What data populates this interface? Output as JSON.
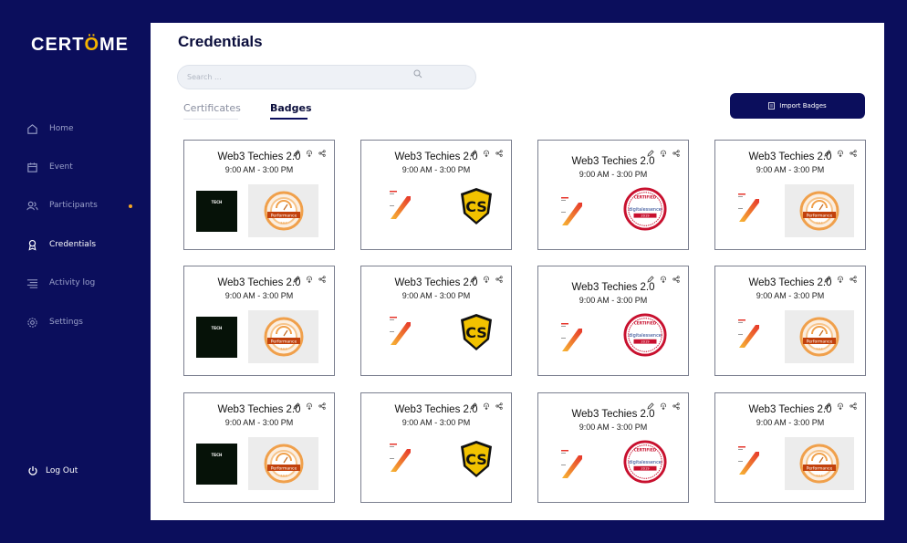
{
  "app": {
    "logo_left": "CERT",
    "logo_crown": "Ö",
    "logo_right": "ME"
  },
  "sidebar": {
    "items": [
      {
        "label": "Home",
        "icon": "home-icon"
      },
      {
        "label": "Event",
        "icon": "calendar-icon"
      },
      {
        "label": "Participants",
        "icon": "users-icon"
      },
      {
        "label": "Credentials",
        "icon": "award-icon"
      },
      {
        "label": "Activity log",
        "icon": "list-icon"
      },
      {
        "label": "Settings",
        "icon": "gear-icon"
      }
    ],
    "logout": "Log Out",
    "notification_color": "#f5a623"
  },
  "main": {
    "title": "Credentials",
    "search_placeholder": "Search ...",
    "tabs": [
      {
        "label": "Certificates"
      },
      {
        "label": "Badges"
      }
    ],
    "import_button": "Import  Badges"
  },
  "cards": [
    {
      "title": "Web3 Techies 2.0",
      "time": "9:00 AM - 3:00 PM",
      "badge": "performance"
    },
    {
      "title": "Web3 Techies 2.0",
      "time": "9:00 AM - 3:00 PM",
      "badge": "cs"
    },
    {
      "title": "Web3 Techies 2.0",
      "time": "9:00 AM - 3:00 PM",
      "badge": "digitalessence"
    },
    {
      "title": "Web3 Techies 2.0",
      "time": "9:00 AM - 3:00 PM",
      "badge": "performance"
    },
    {
      "title": "Web3 Techies 2.0",
      "time": "9:00 AM - 3:00 PM",
      "badge": "performance"
    },
    {
      "title": "Web3 Techies 2.0",
      "time": "9:00 AM - 3:00 PM",
      "badge": "cs"
    },
    {
      "title": "Web3 Techies 2.0",
      "time": "9:00 AM - 3:00 PM",
      "badge": "digitalessence"
    },
    {
      "title": "Web3 Techies 2.0",
      "time": "9:00 AM - 3:00 PM",
      "badge": "performance"
    },
    {
      "title": "Web3 Techies 2.0",
      "time": "9:00 AM - 3:00 PM",
      "badge": "performance"
    },
    {
      "title": "Web3 Techies 2.0",
      "time": "9:00 AM - 3:00 PM",
      "badge": "cs"
    },
    {
      "title": "Web3 Techies 2.0",
      "time": "9:00 AM - 3:00 PM",
      "badge": "digitalessence"
    },
    {
      "title": "Web3 Techies 2.0",
      "time": "9:00 AM - 3:00 PM",
      "badge": "performance"
    }
  ],
  "badge_text": {
    "performance": "Performance",
    "tech": "TECH",
    "cs": "CS",
    "certified": "CERTIFIED",
    "digitalessence": "digitalessence",
    "year": "2019"
  },
  "colors": {
    "brand_navy": "#0b0e5c",
    "accent_orange": "#f5a623"
  }
}
